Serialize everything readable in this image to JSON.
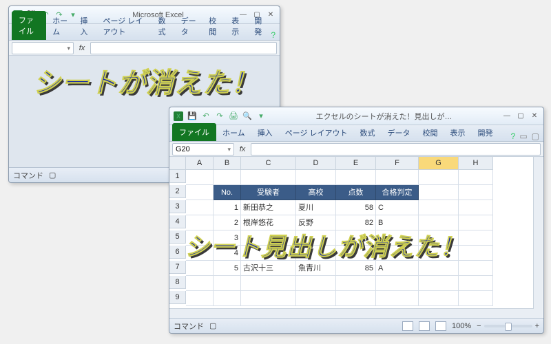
{
  "overlays": {
    "text1": "シートが消えた！",
    "text2": "シート見出しが消えた！"
  },
  "window1": {
    "title": "Microsoft Excel",
    "tabs": {
      "file": "ファイル",
      "home": "ホーム",
      "insert": "挿入",
      "layout": "ページ レイアウト",
      "formulas": "数式",
      "data": "データ",
      "review": "校閲",
      "view": "表示",
      "dev": "開発"
    },
    "namebox": "",
    "status_left": "コマンド"
  },
  "window2": {
    "title": "エクセルのシートが消えた！見出しが…",
    "tabs": {
      "file": "ファイル",
      "home": "ホーム",
      "insert": "挿入",
      "layout": "ページ レイアウト",
      "formulas": "数式",
      "data": "データ",
      "review": "校閲",
      "view": "表示",
      "dev": "開発"
    },
    "namebox": "G20",
    "columns": [
      "A",
      "B",
      "C",
      "D",
      "E",
      "F",
      "G",
      "H"
    ],
    "rows": [
      "1",
      "2",
      "3",
      "4",
      "5",
      "6",
      "7",
      "8",
      "9"
    ],
    "table": {
      "headers": {
        "no": "No.",
        "examinee": "受験者",
        "school": "高校",
        "score": "点数",
        "result": "合格判定"
      },
      "data": [
        {
          "no": "1",
          "examinee": "新田恭之",
          "school": "夏川",
          "score": "58",
          "result": "C"
        },
        {
          "no": "2",
          "examinee": "根岸悠花",
          "school": "反野",
          "score": "82",
          "result": "B"
        },
        {
          "no": "3",
          "examinee": "",
          "school": "",
          "score": "",
          "result": ""
        },
        {
          "no": "4",
          "examinee": "",
          "school": "",
          "score": "",
          "result": ""
        },
        {
          "no": "5",
          "examinee": "古沢十三",
          "school": "魚青川",
          "score": "85",
          "result": "A"
        }
      ]
    },
    "status_left": "コマンド",
    "zoom": "100%"
  }
}
